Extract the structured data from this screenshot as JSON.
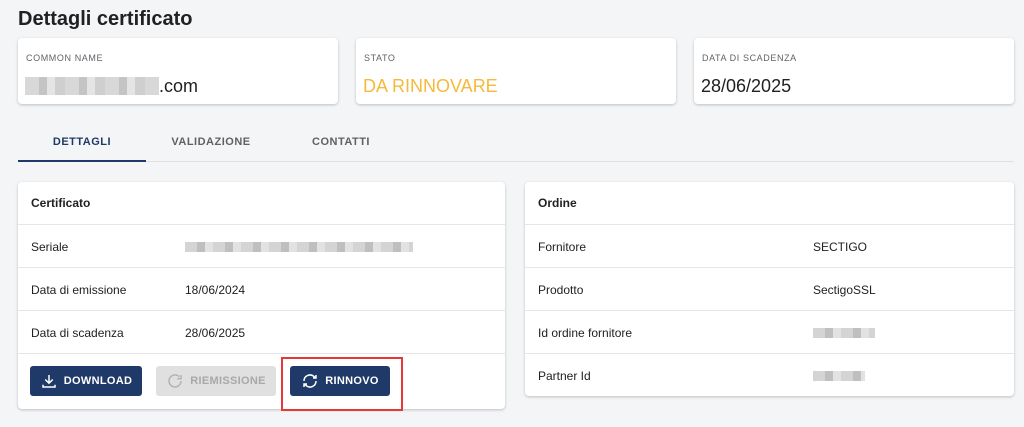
{
  "page": {
    "title": "Dettagli certificato"
  },
  "cards": {
    "common_name": {
      "label": "COMMON NAME",
      "value_suffix": ".com"
    },
    "status": {
      "label": "STATO",
      "value": "DA RINNOVARE",
      "color": "#f6b93b"
    },
    "expiry": {
      "label": "DATA DI SCADENZA",
      "value": "28/06/2025"
    }
  },
  "tabs": [
    {
      "label": "DETTAGLI",
      "active": true
    },
    {
      "label": "VALIDAZIONE",
      "active": false
    },
    {
      "label": "CONTATTI",
      "active": false
    }
  ],
  "certificate": {
    "title": "Certificato",
    "rows": [
      {
        "label": "Seriale",
        "value": ""
      },
      {
        "label": "Data di emissione",
        "value": "18/06/2024"
      },
      {
        "label": "Data di scadenza",
        "value": "28/06/2025"
      }
    ],
    "buttons": {
      "download": "DOWNLOAD",
      "reissue": "RIEMISSIONE",
      "renew": "RINNOVO"
    }
  },
  "order": {
    "title": "Ordine",
    "rows": [
      {
        "label": "Fornitore",
        "value": "SECTIGO"
      },
      {
        "label": "Prodotto",
        "value": "SectigoSSL"
      },
      {
        "label": "Id ordine fornitore",
        "value": ""
      },
      {
        "label": "Partner Id",
        "value": ""
      }
    ]
  },
  "theme": {
    "primary": "#1f3a68",
    "warning": "#f6b93b",
    "highlight": "#e53935"
  }
}
